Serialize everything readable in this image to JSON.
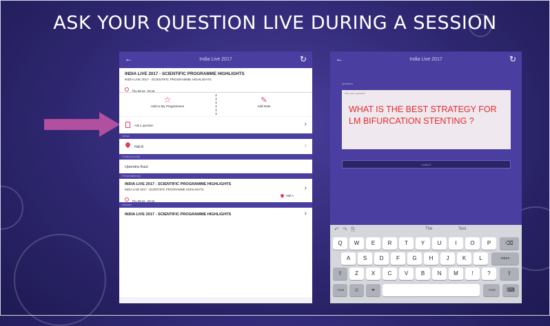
{
  "slide": {
    "title": "ASK YOUR QUESTION LIVE DURING A SESSION"
  },
  "left_panel": {
    "header_title": "India Live 2017",
    "session": {
      "title": "INDIA LIVE 2017 - SCIENTIFIC PROGRAMME HIGHLIGHTS",
      "subtitle": "INDIA LIVE 2017 - SCIENTIFIC PROGRAMME HIGHLIGHTS",
      "time": "Thu 09:15 - 09:15"
    },
    "actions": {
      "add_programme": "Add to My Programmes",
      "add_note": "Add Note"
    },
    "ask_question": "Ask a question",
    "venue_label": "Venue",
    "hall": "Hall A",
    "speaker_label": "Chairperson(s)",
    "speaker": "Upendra Kaul",
    "presentations_label": "Presentation(s)",
    "presentation": {
      "title": "INDIA LIVE 2017 - SCIENTIFIC PROGRAMME HIGHLIGHTS",
      "subtitle": "INDIA LIVE 2017 - SCIENTIFIC PROGRAMME HIGHLIGHTS",
      "time": "Thu 09:15 - 09:15",
      "hall": "Hall A"
    },
    "related_label": "Session",
    "related": "INDIA LIVE 2017 - SCIENTIFIC PROGRAMME HIGHLIGHTS"
  },
  "right_panel": {
    "header_title": "India Live 2017",
    "section_label": "Question",
    "field_label": "Ask your question",
    "question": "WHAT IS THE BEST STRATEGY FOR LM BIFURCATION STENTING ?",
    "submit": "SUBMIT",
    "keyboard": {
      "suggestions": [
        "The",
        "Test"
      ],
      "row1": [
        "Q",
        "W",
        "E",
        "R",
        "T",
        "Y",
        "U",
        "I",
        "O",
        "P"
      ],
      "row2": [
        "A",
        "S",
        "D",
        "F",
        "G",
        "H",
        "J",
        "K",
        "L"
      ],
      "row3": [
        "Z",
        "X",
        "C",
        "V",
        "B",
        "N",
        "M",
        "!",
        "?"
      ],
      "return_label": "return",
      "numbers_label": ".?123"
    }
  },
  "colors": {
    "accent": "#4a3fa0",
    "arrow": "#b0509f",
    "question_text": "#e32a2a"
  }
}
